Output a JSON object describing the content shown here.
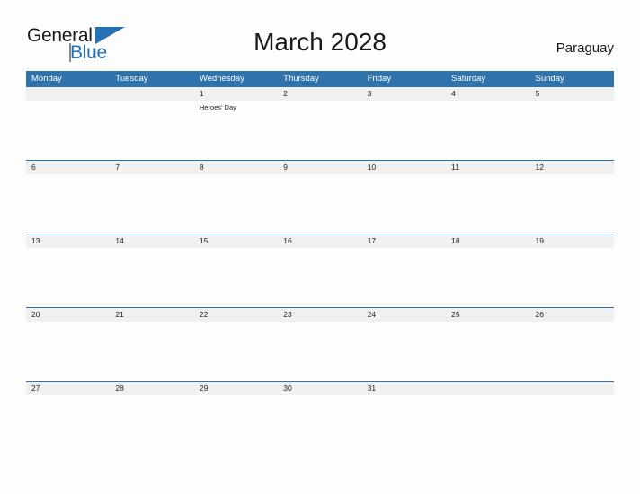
{
  "brand": {
    "name_part1": "General",
    "name_part2": "Blue",
    "flag_icon": "triangle-flag-icon",
    "accent_color": "#2671b3"
  },
  "header": {
    "title": "March 2028",
    "country": "Paraguay"
  },
  "colors": {
    "header_blue": "#2f73ad",
    "date_band_gray": "#f0f0f0",
    "page_background": "#fdfdfd",
    "text_dark": "#1f1f1f",
    "weekday_text": "#ffffff"
  },
  "calendar": {
    "month": "March",
    "year": "2028",
    "weekdays": [
      "Monday",
      "Tuesday",
      "Wednesday",
      "Thursday",
      "Friday",
      "Saturday",
      "Sunday"
    ],
    "weeks": [
      {
        "days": [
          {
            "date": "",
            "event": ""
          },
          {
            "date": "",
            "event": ""
          },
          {
            "date": "1",
            "event": "Heroes' Day"
          },
          {
            "date": "2",
            "event": ""
          },
          {
            "date": "3",
            "event": ""
          },
          {
            "date": "4",
            "event": ""
          },
          {
            "date": "5",
            "event": ""
          }
        ]
      },
      {
        "days": [
          {
            "date": "6",
            "event": ""
          },
          {
            "date": "7",
            "event": ""
          },
          {
            "date": "8",
            "event": ""
          },
          {
            "date": "9",
            "event": ""
          },
          {
            "date": "10",
            "event": ""
          },
          {
            "date": "11",
            "event": ""
          },
          {
            "date": "12",
            "event": ""
          }
        ]
      },
      {
        "days": [
          {
            "date": "13",
            "event": ""
          },
          {
            "date": "14",
            "event": ""
          },
          {
            "date": "15",
            "event": ""
          },
          {
            "date": "16",
            "event": ""
          },
          {
            "date": "17",
            "event": ""
          },
          {
            "date": "18",
            "event": ""
          },
          {
            "date": "19",
            "event": ""
          }
        ]
      },
      {
        "days": [
          {
            "date": "20",
            "event": ""
          },
          {
            "date": "21",
            "event": ""
          },
          {
            "date": "22",
            "event": ""
          },
          {
            "date": "23",
            "event": ""
          },
          {
            "date": "24",
            "event": ""
          },
          {
            "date": "25",
            "event": ""
          },
          {
            "date": "26",
            "event": ""
          }
        ]
      },
      {
        "days": [
          {
            "date": "27",
            "event": ""
          },
          {
            "date": "28",
            "event": ""
          },
          {
            "date": "29",
            "event": ""
          },
          {
            "date": "30",
            "event": ""
          },
          {
            "date": "31",
            "event": ""
          },
          {
            "date": "",
            "event": ""
          },
          {
            "date": "",
            "event": ""
          }
        ]
      }
    ]
  }
}
